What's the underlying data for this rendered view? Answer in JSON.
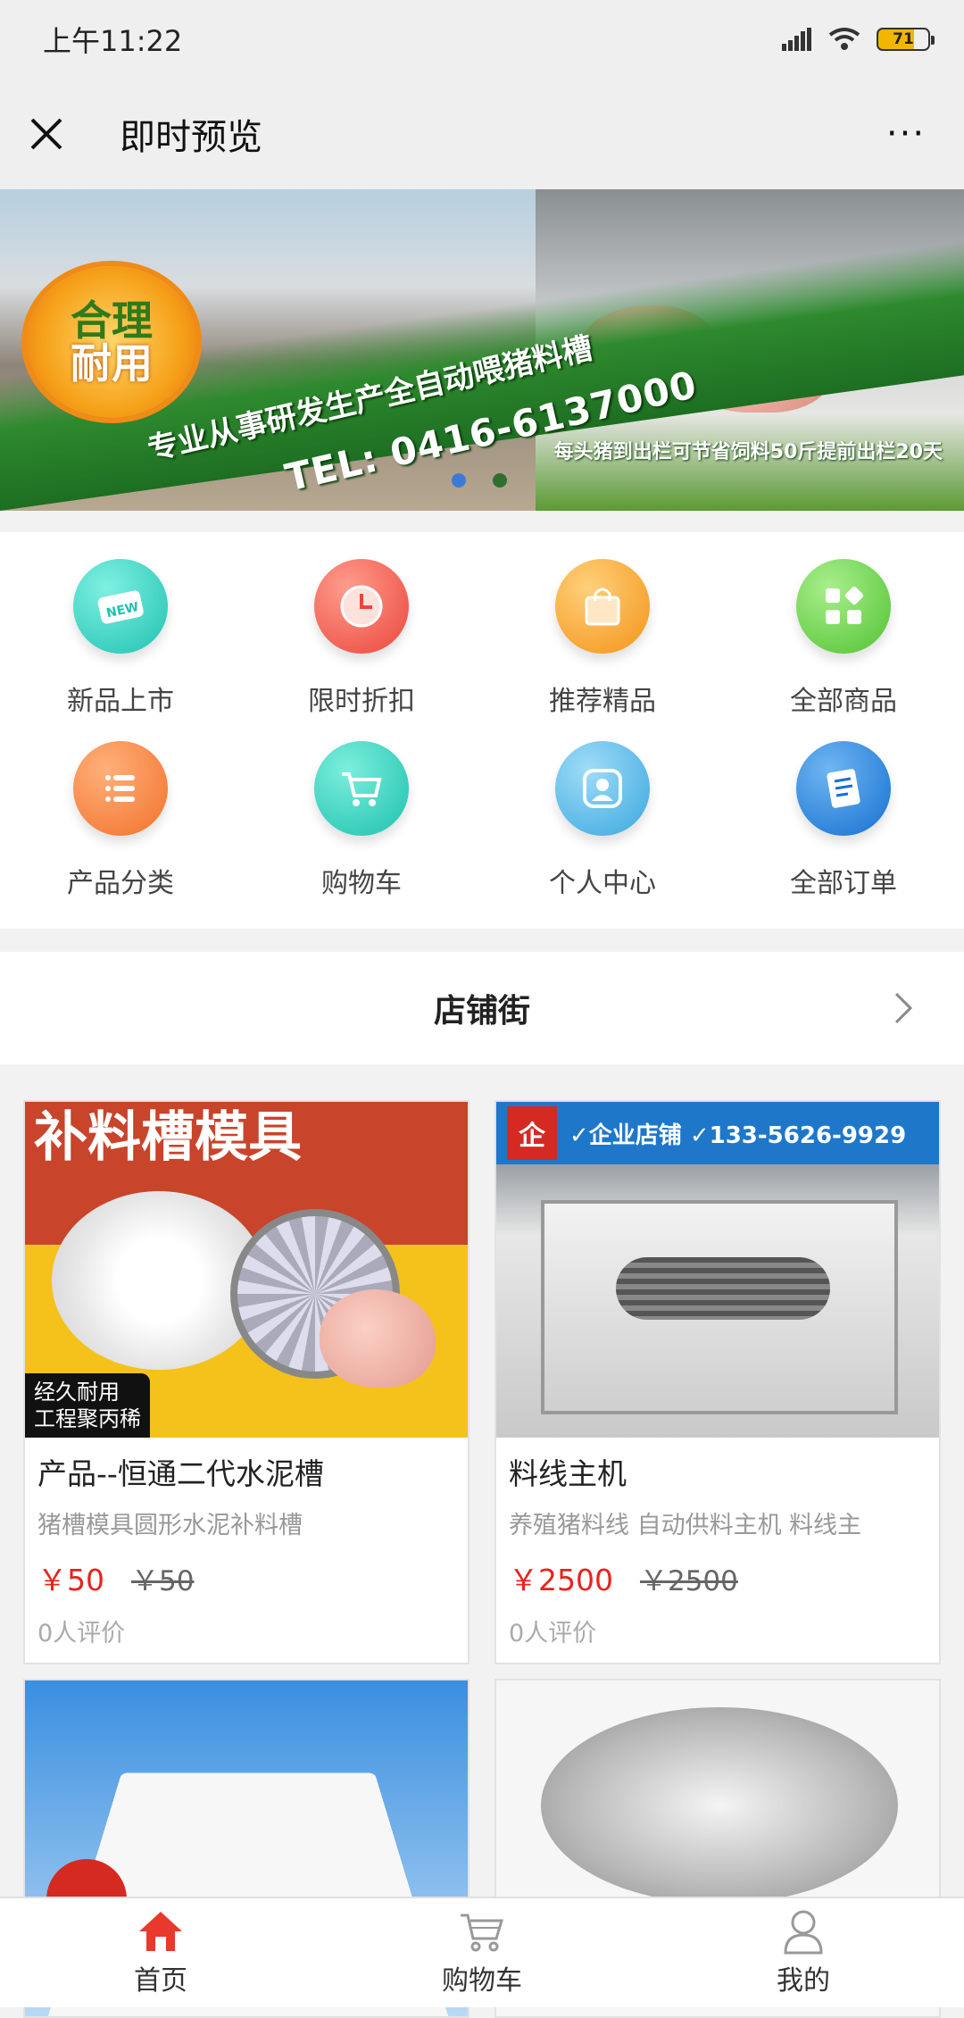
{
  "status_bar": {
    "time": "上午11:22",
    "battery": "71"
  },
  "title_bar": {
    "title": "即时预览",
    "more": "···"
  },
  "banner": {
    "badge_line1": "合理",
    "badge_line2": "耐用",
    "slogan": "专业从事研发生产全自动喂猪料槽",
    "tel": "TEL: 0416-6137000",
    "note": "每头猪到出栏可节省饲料50斤提前出栏20天",
    "slides": 2,
    "active_slide": 1
  },
  "menu": {
    "items": [
      {
        "label": "新品上市",
        "icon": "new-icon",
        "color": "#2fd3c2"
      },
      {
        "label": "限时折扣",
        "icon": "clock-icon",
        "color": "#f0574d"
      },
      {
        "label": "推荐精品",
        "icon": "bag-icon",
        "color": "#f7a324"
      },
      {
        "label": "全部商品",
        "icon": "grid-icon",
        "color": "#6cd14a"
      },
      {
        "label": "产品分类",
        "icon": "list-icon",
        "color": "#f58637"
      },
      {
        "label": "购物车",
        "icon": "cart-icon",
        "color": "#2ed0bd"
      },
      {
        "label": "个人中心",
        "icon": "user-icon",
        "color": "#4db8e8"
      },
      {
        "label": "全部订单",
        "icon": "order-icon",
        "color": "#1f82de"
      }
    ]
  },
  "shop_street": {
    "title": "店铺街"
  },
  "products": [
    {
      "name": "产品--恒通二代水泥槽",
      "desc": "猪槽模具圆形水泥补料槽",
      "price": "￥50",
      "old_price": "￥50",
      "reviews": "0人评价",
      "image_heading": "补料槽模具",
      "image_tag_1": "经久耐用",
      "image_tag_2": "工程聚丙稀"
    },
    {
      "name": "料线主机",
      "desc": "养殖猪料线 自动供料主机 料线主",
      "price": "￥2500",
      "old_price": "￥2500",
      "reviews": "0人评价",
      "image_badge": "企",
      "image_bar": "✓企业店铺 ✓133-5626-9929"
    }
  ],
  "tabbar": {
    "items": [
      {
        "label": "首页",
        "icon": "home-icon",
        "active": true,
        "color": "#e8392c"
      },
      {
        "label": "购物车",
        "icon": "cart-icon",
        "active": false,
        "color": "#999999"
      },
      {
        "label": "我的",
        "icon": "user-icon",
        "active": false,
        "color": "#999999"
      }
    ]
  }
}
